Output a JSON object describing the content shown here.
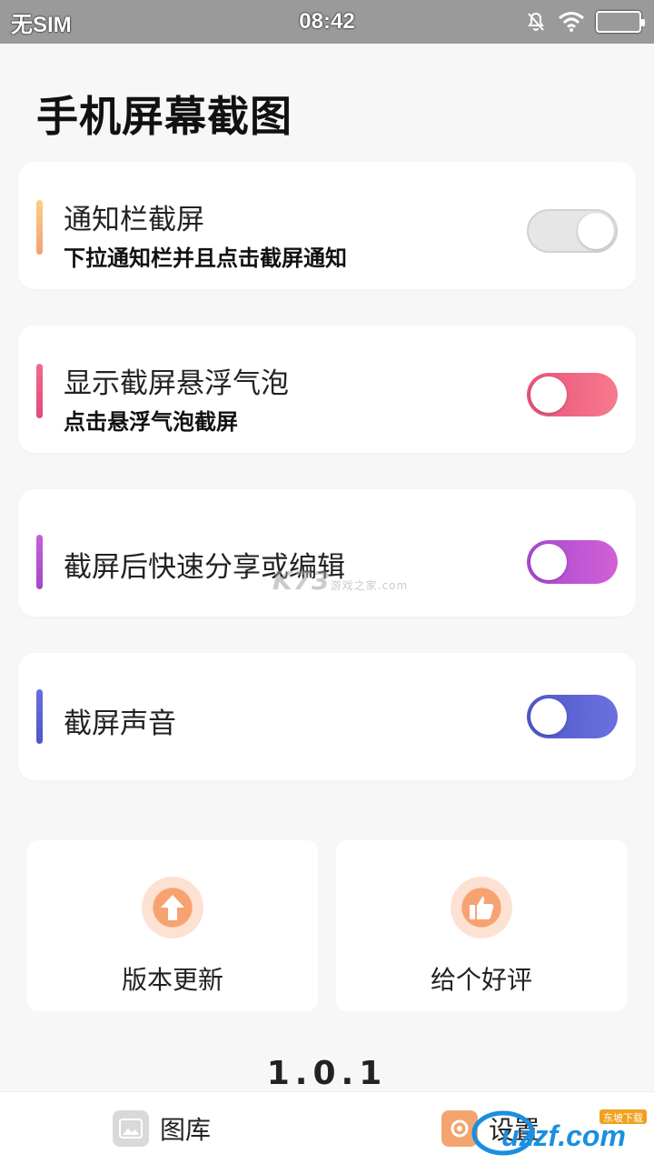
{
  "status_bar": {
    "carrier": "无SIM",
    "time": "08:42"
  },
  "title": "手机屏幕截图",
  "settings": [
    {
      "title": "通知栏截屏",
      "subtitle": "下拉通知栏并且点击截屏通知",
      "enabled": false,
      "accent": "#f5b97a"
    },
    {
      "title": "显示截屏悬浮气泡",
      "subtitle": "点击悬浮气泡截屏",
      "enabled": true,
      "accent": "#ee5a83"
    },
    {
      "title": "截屏后快速分享或编辑",
      "subtitle": "",
      "enabled": true,
      "accent": "#b553d0"
    },
    {
      "title": "截屏声音",
      "subtitle": "",
      "enabled": true,
      "accent": "#5b63d6"
    }
  ],
  "actions": [
    {
      "label": "版本更新",
      "icon": "arrow-up-icon"
    },
    {
      "label": "给个好评",
      "icon": "thumbs-up-icon"
    }
  ],
  "version": "1.0.1",
  "nav": [
    {
      "label": "图库",
      "icon": "gallery-icon"
    },
    {
      "label": "设置",
      "icon": "settings-icon"
    }
  ],
  "watermark": {
    "main": "K73",
    "sub": "游戏之家",
    "domain": ".com"
  },
  "logo": {
    "text": "uzzf.com",
    "badge": "东坡下载"
  }
}
